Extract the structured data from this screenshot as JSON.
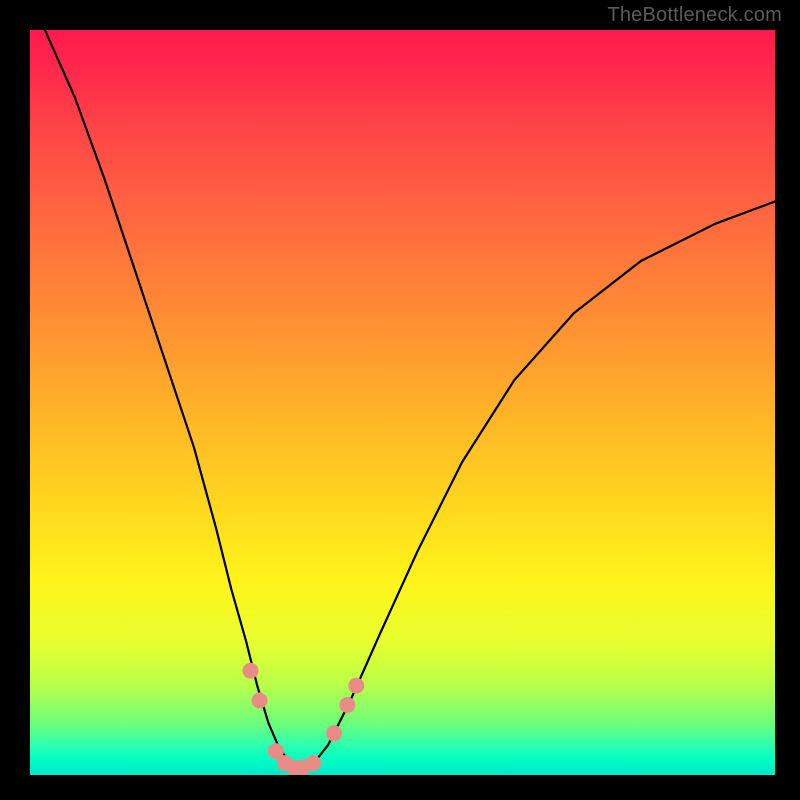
{
  "watermark": "TheBottleneck.com",
  "chart_data": {
    "type": "line",
    "title": "",
    "xlabel": "",
    "ylabel": "",
    "xlim": [
      0,
      100
    ],
    "ylim": [
      0,
      100
    ],
    "grid": false,
    "legend": false,
    "series": [
      {
        "name": "bottleneck-curve",
        "color": "#000000",
        "x": [
          2,
          6,
          10,
          14,
          18,
          22,
          25,
          27,
          29,
          30.5,
          32,
          33.5,
          35,
          36,
          37,
          38,
          40,
          43,
          47,
          52,
          58,
          65,
          73,
          82,
          92,
          100
        ],
        "y": [
          100,
          91,
          80,
          68,
          56,
          44,
          33,
          25,
          18,
          12,
          7,
          3.5,
          1.5,
          0.8,
          0.8,
          1.5,
          4,
          10,
          19,
          30,
          42,
          53,
          62,
          69,
          74,
          77
        ]
      }
    ],
    "markers": {
      "name": "highlight-points",
      "color": "#e98b87",
      "radius_px": 8,
      "points": [
        {
          "x": 29.6,
          "y": 14.0
        },
        {
          "x": 30.8,
          "y": 10.0
        },
        {
          "x": 33.0,
          "y": 3.2
        },
        {
          "x": 34.2,
          "y": 1.6
        },
        {
          "x": 35.4,
          "y": 1.0
        },
        {
          "x": 36.6,
          "y": 1.0
        },
        {
          "x": 38.0,
          "y": 1.6
        },
        {
          "x": 40.8,
          "y": 5.6
        },
        {
          "x": 42.6,
          "y": 9.4
        },
        {
          "x": 43.8,
          "y": 12.0
        }
      ]
    }
  }
}
